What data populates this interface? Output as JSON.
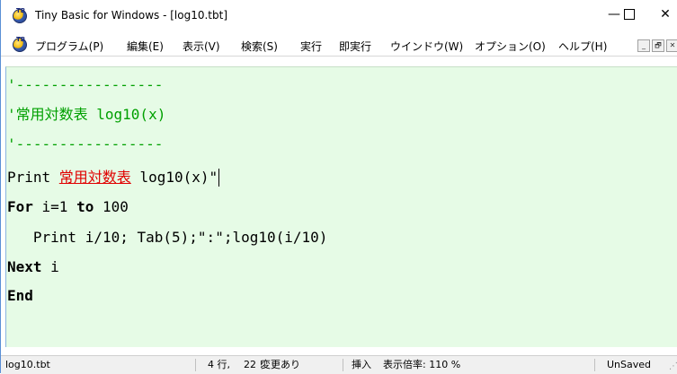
{
  "window": {
    "title": "Tiny Basic for Windows - [log10.tbt]",
    "icon": "tiny-basic-app-icon",
    "controls": {
      "minimize": "—",
      "close": "✕"
    }
  },
  "menu": {
    "items": [
      "プログラム(P)",
      "編集(E)",
      "表示(V)",
      "検索(S)",
      "実行",
      "即実行",
      "ウインドウ(W)",
      "オプション(O)",
      "ヘルプ(H)"
    ],
    "mdi": {
      "minimize": "_",
      "restore": "🗗",
      "close": "✕"
    }
  },
  "editor": {
    "lines": {
      "l1": "'-----------------",
      "l2": "'常用対数表 log10(x)",
      "l3": "'-----------------",
      "l4_a": "Print ",
      "l4_b": "常用対数表",
      "l4_c": " log10(x)\"",
      "l5_kw1": "For",
      "l5_mid": " i=1 ",
      "l5_kw2": "to",
      "l5_end": " 100",
      "l6": "   Print i/10; Tab(5);\":\";log10(i/10)",
      "l7_kw": "Next",
      "l7_end": " i",
      "l8_kw": "End"
    },
    "background": "#e6fbe6",
    "comment_color": "#00a000",
    "error_color": "#e00000"
  },
  "status": {
    "file": "log10.tbt",
    "line": "4 行,",
    "col": "22 !",
    "modified": "変更あり",
    "mode": "挿入",
    "zoom": "表示倍率: 110 %",
    "saved": "UnSaved"
  }
}
